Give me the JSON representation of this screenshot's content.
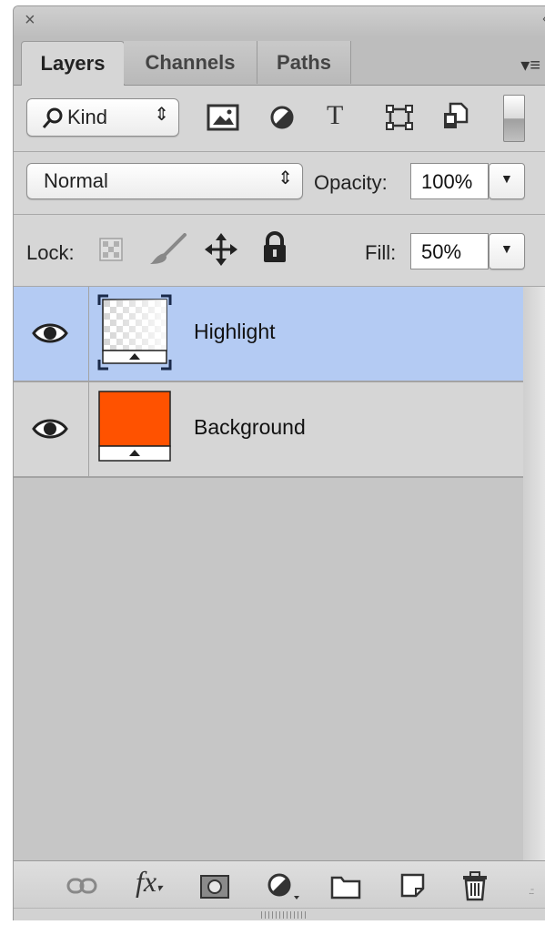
{
  "window": {
    "close_glyph": "×",
    "collapse_glyph": "«"
  },
  "tabs": [
    {
      "label": "Layers",
      "active": true
    },
    {
      "label": "Channels",
      "active": false
    },
    {
      "label": "Paths",
      "active": false
    }
  ],
  "panel_menu_glyph": "▾≡",
  "filter": {
    "kind_label": "Kind",
    "icons": [
      "pixel-layer-filter-icon",
      "adjustment-layer-filter-icon",
      "type-layer-filter-icon",
      "shape-layer-filter-icon",
      "smart-object-filter-icon",
      "filter-toggle-switch"
    ]
  },
  "blend": {
    "mode": "Normal",
    "opacity_label": "Opacity:",
    "opacity_value": "100%"
  },
  "lock": {
    "label": "Lock:",
    "fill_label": "Fill:",
    "fill_value": "50%"
  },
  "layers": [
    {
      "name": "Highlight",
      "selected": true,
      "visible": true,
      "thumb": "transparent-checker"
    },
    {
      "name": "Background",
      "selected": false,
      "visible": true,
      "thumb_color": "#ff5200"
    }
  ],
  "bottom_icons": [
    "link-icon",
    "fx-icon",
    "mask-icon",
    "adjustment-icon",
    "folder-icon",
    "new-layer-icon",
    "trash-icon"
  ],
  "colors": {
    "selection": "#b4cbf3",
    "background_layer": "#ff5200"
  }
}
